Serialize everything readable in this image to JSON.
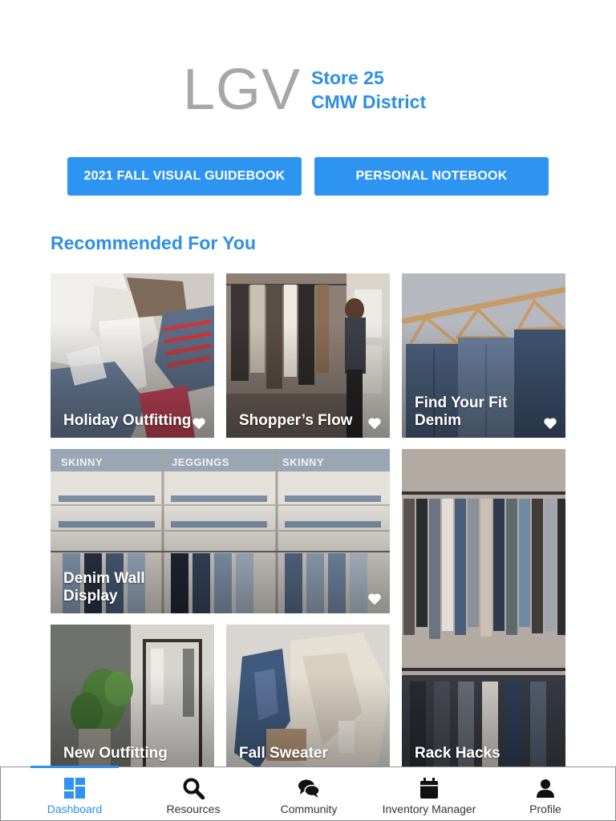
{
  "header": {
    "logo": "LGV",
    "store_line": "Store 25",
    "district_line": "CMW District"
  },
  "buttons": {
    "guidebook": "2021 FALL VISUAL GUIDEBOOK",
    "notebook": "PERSONAL NOTEBOOK"
  },
  "section": {
    "title": "Recommended For You"
  },
  "tiles": [
    {
      "title": "Holiday Outfitting"
    },
    {
      "title": "Shopper’s Flow"
    },
    {
      "title": "Find Your Fit Denim"
    },
    {
      "title": "Denim Wall Display",
      "signs": [
        "SKINNY",
        "JEGGINGS",
        "SKINNY"
      ]
    },
    {
      "title": "Rack Hacks"
    },
    {
      "title": "New Outfitting"
    },
    {
      "title": "Fall Sweater"
    }
  ],
  "bottom_nav": {
    "items": [
      {
        "label": "Dashboard",
        "icon": "dashboard-icon",
        "active": true
      },
      {
        "label": "Resources",
        "icon": "search-icon",
        "active": false
      },
      {
        "label": "Community",
        "icon": "chat-bubbles-icon",
        "active": false
      },
      {
        "label": "Inventory Manager",
        "icon": "calendar-icon",
        "active": false
      },
      {
        "label": "Profile",
        "icon": "user-icon",
        "active": false
      }
    ]
  },
  "colors": {
    "accent": "#2d94f2",
    "logo_gray": "#a7a7a7"
  }
}
